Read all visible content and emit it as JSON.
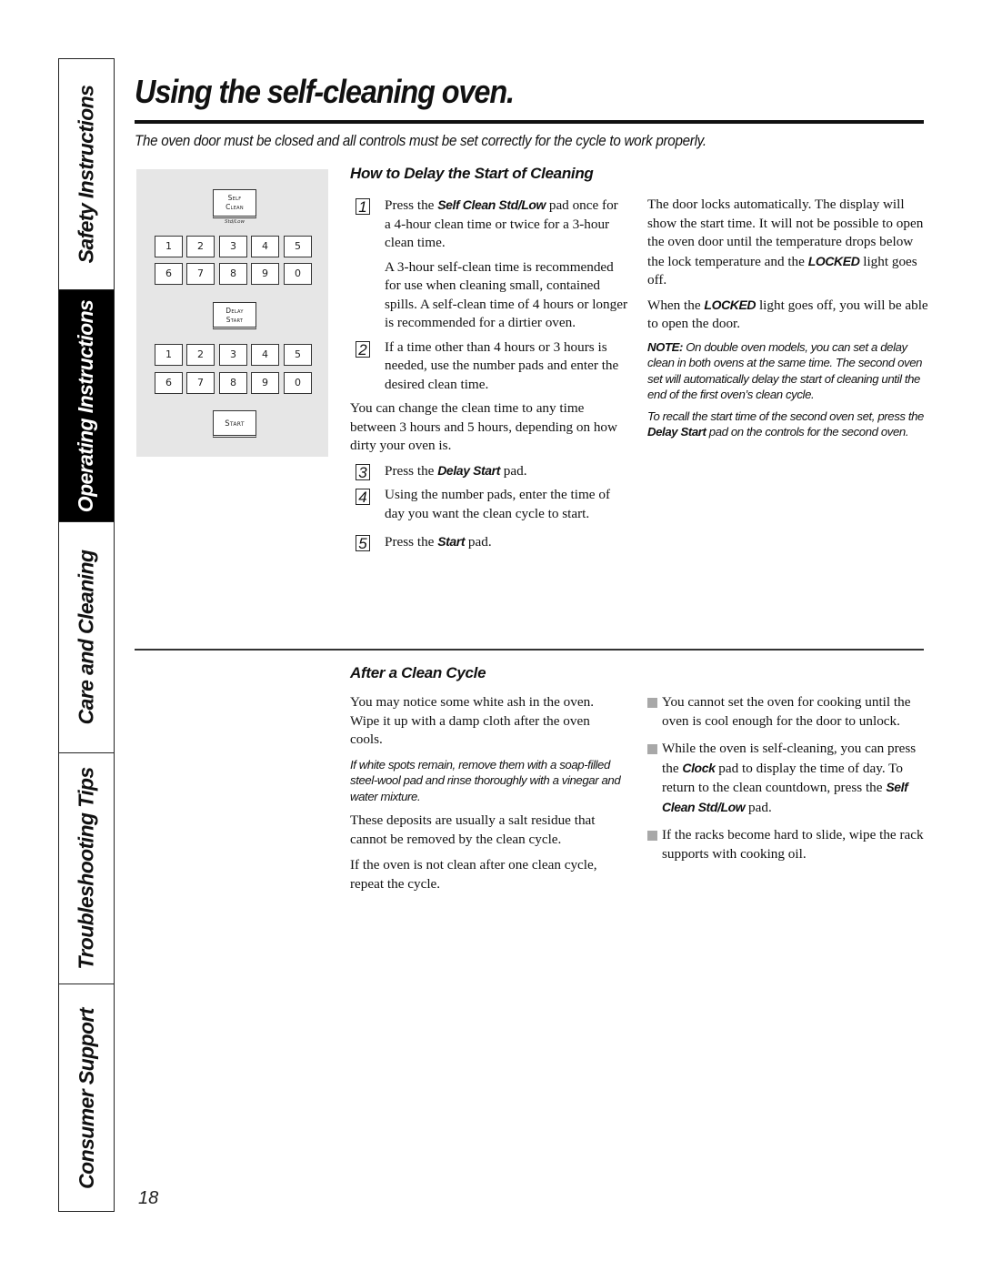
{
  "side_tabs": [
    {
      "label": "Safety Instructions",
      "active": false
    },
    {
      "label": "Operating Instructions",
      "active": true
    },
    {
      "label": "Care and Cleaning",
      "active": false
    },
    {
      "label": "Troubleshooting Tips",
      "active": false
    },
    {
      "label": "Consumer Support",
      "active": false
    }
  ],
  "header": {
    "title": "Using the self-cleaning oven.",
    "subtitle": "The oven door must be closed and all controls must be set correctly for the cycle to work properly."
  },
  "control_panel": {
    "self_clean_line1": "Self",
    "self_clean_line2": "Clean",
    "self_clean_caption": "Std/Low",
    "number_pads_row1": [
      "1",
      "2",
      "3",
      "4",
      "5"
    ],
    "number_pads_row2": [
      "6",
      "7",
      "8",
      "9",
      "0"
    ],
    "delay_start_line1": "Delay",
    "delay_start_line2": "Start",
    "start_label": "Start"
  },
  "delay_section": {
    "heading": "How to Delay the Start of Cleaning",
    "steps": [
      {
        "num": "1",
        "pre": "Press the ",
        "bold": "Self Clean Std/Low",
        "post": " pad once for a 4-hour clean time or twice for a 3-hour clean time."
      },
      {
        "num": "2",
        "pre": "If a time other than 4 hours or 3 hours is needed, use the number pads and enter the desired clean time.",
        "bold": "",
        "post": ""
      },
      {
        "num": "3",
        "pre": "Press the ",
        "bold": "Delay Start",
        "post": " pad."
      },
      {
        "num": "4",
        "pre": "Using the number pads, enter the time of day you want the clean cycle to start.",
        "bold": "",
        "post": ""
      },
      {
        "num": "5",
        "pre": "Press the ",
        "bold": "Start",
        "post": " pad."
      }
    ],
    "step1_extra": "A 3-hour self-clean time is recommended for use when cleaning small, contained spills. A self-clean time of 4 hours or longer is recommended for a dirtier oven.",
    "change_time": "You can change the clean time to any time between 3 hours and 5 hours, depending on how dirty your oven is.",
    "right_p1_pre": "The door locks automatically. The display will show the start time. It will not be possible to open the oven door until the temperature drops below the lock temperature and the ",
    "right_p1_bold": "LOCKED",
    "right_p1_post": " light goes off.",
    "right_p2_pre": "When the ",
    "right_p2_bold": "LOCKED",
    "right_p2_post": " light goes off, you will be able to open the door.",
    "note_label": "NOTE:",
    "note_text": " On double oven models, you can set a delay clean in both ovens at the same time. The second oven set will automatically delay the start of cleaning until the end of the first oven’s clean cycle.",
    "recall_pre": "To recall the start time of the second oven set, press the ",
    "recall_bold": "Delay Start",
    "recall_post": " pad on the controls for the second oven."
  },
  "after_section": {
    "heading": "After a Clean Cycle",
    "p1": "You may notice some white ash in the oven. Wipe it up with a damp cloth after the oven cools.",
    "italic_note": "If white spots remain, remove them with a soap-filled steel-wool pad and rinse thoroughly with a vinegar and water mixture.",
    "p2": "These deposits are usually a salt residue that cannot be removed by the clean cycle.",
    "p3": "If the oven is not clean after one clean cycle, repeat the cycle.",
    "bullets": [
      {
        "pre": "You cannot set the oven for cooking until the oven is cool enough for the door to unlock.",
        "bold": "",
        "mid": "",
        "bold2": "",
        "post": ""
      },
      {
        "pre": "While the oven is self-cleaning, you can press the ",
        "bold": "Clock",
        "mid": " pad to display the time of day. To return to the clean countdown, press the ",
        "bold2": "Self Clean Std/Low",
        "post": " pad."
      },
      {
        "pre": "If the racks become hard to slide, wipe the rack supports with cooking oil.",
        "bold": "",
        "mid": "",
        "bold2": "",
        "post": ""
      }
    ]
  },
  "page_number": "18"
}
